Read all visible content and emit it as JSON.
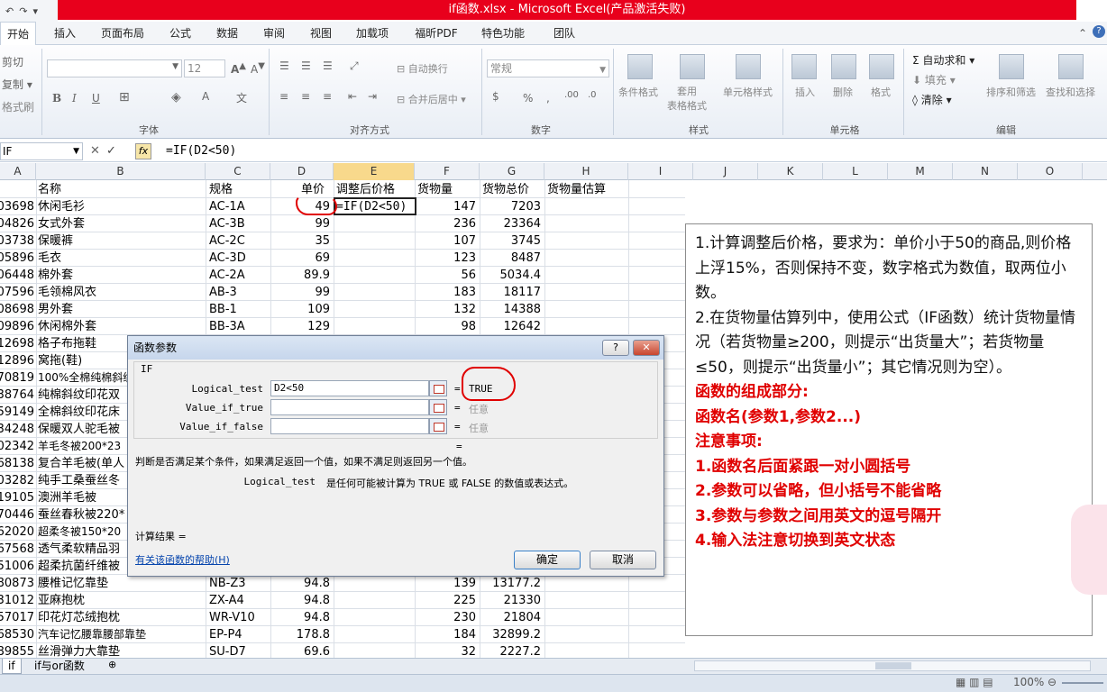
{
  "window": {
    "title": "if函数.xlsx - Microsoft Excel(产品激活失败)"
  },
  "tabs": [
    "开始",
    "插入",
    "页面布局",
    "公式",
    "数据",
    "审阅",
    "视图",
    "加载项",
    "福昕PDF",
    "特色功能",
    "团队"
  ],
  "ribbon": {
    "clipboard": {
      "cut": "剪切",
      "copy": "复制 ▾",
      "format_painter": "格式刷"
    },
    "font": {
      "size": "12",
      "group_label": "字体"
    },
    "alignment": {
      "wrap": "自动换行",
      "merge": "合并后居中 ▾",
      "group_label": "对齐方式"
    },
    "number": {
      "format": "常规",
      "group_label": "数字"
    },
    "styles": {
      "conditional": "条件格式",
      "table": "套用\n表格格式",
      "cell_styles": "单元格样式",
      "group_label": "样式"
    },
    "cells": {
      "insert": "插入",
      "delete": "删除",
      "format": "格式",
      "group_label": "单元格"
    },
    "editing": {
      "autosum": "自动求和 ▾",
      "fill": "填充 ▾",
      "clear": "清除 ▾",
      "sort_filter": "排序和筛选",
      "find_select": "查找和选择",
      "group_label": "编辑"
    }
  },
  "formula_bar": {
    "name_box": "IF",
    "formula": "=IF(D2<50)"
  },
  "columns": [
    "A",
    "B",
    "C",
    "D",
    "E",
    "F",
    "G",
    "H",
    "I",
    "J",
    "K",
    "L",
    "M",
    "N",
    "O"
  ],
  "header_row": {
    "b": "名称",
    "c": "规格",
    "d": "单价",
    "e": "调整后价格",
    "f": "货物量",
    "g": "货物总价",
    "h": "货物量估算"
  },
  "rows": [
    {
      "a": "03698",
      "b": "休闲毛衫",
      "c": "AC-1A",
      "d": "49",
      "e": "=IF(D2<50)",
      "f": "147",
      "g": "7203"
    },
    {
      "a": "04826",
      "b": "女式外套",
      "c": "AC-3B",
      "d": "99",
      "e": "",
      "f": "236",
      "g": "23364"
    },
    {
      "a": "03738",
      "b": "保暖裤",
      "c": "AC-2C",
      "d": "35",
      "e": "",
      "f": "107",
      "g": "3745"
    },
    {
      "a": "05896",
      "b": "毛衣",
      "c": "AC-3D",
      "d": "69",
      "e": "",
      "f": "123",
      "g": "8487"
    },
    {
      "a": "06448",
      "b": "棉外套",
      "c": "AC-2A",
      "d": "89.9",
      "e": "",
      "f": "56",
      "g": "5034.4"
    },
    {
      "a": "07596",
      "b": "毛领棉风衣",
      "c": "AB-3",
      "d": "99",
      "e": "",
      "f": "183",
      "g": "18117"
    },
    {
      "a": "08698",
      "b": "男外套",
      "c": "BB-1",
      "d": "109",
      "e": "",
      "f": "132",
      "g": "14388"
    },
    {
      "a": "09896",
      "b": "休闲棉外套",
      "c": "BB-3A",
      "d": "129",
      "e": "",
      "f": "98",
      "g": "12642"
    },
    {
      "a": "12698",
      "b": "格子布拖鞋",
      "c": "",
      "d": "",
      "e": "",
      "f": "",
      "g": ""
    },
    {
      "a": "12896",
      "b": "窝拖(鞋)",
      "c": "",
      "d": "",
      "e": "",
      "f": "",
      "g": ""
    },
    {
      "a": "70819",
      "b": "100%全棉纯棉斜纹",
      "c": "",
      "d": "",
      "e": "",
      "f": "",
      "g": ""
    },
    {
      "a": "38764",
      "b": "纯棉斜纹印花双",
      "c": "",
      "d": "",
      "e": "",
      "f": "",
      "g": ""
    },
    {
      "a": "59149",
      "b": "全棉斜纹印花床",
      "c": "",
      "d": "",
      "e": "",
      "f": "",
      "g": ""
    },
    {
      "a": "34248",
      "b": "保暖双人驼毛被",
      "c": "",
      "d": "",
      "e": "",
      "f": "",
      "g": ""
    },
    {
      "a": "02342",
      "b": "羊毛冬被200*23",
      "c": "",
      "d": "",
      "e": "",
      "f": "",
      "g": ""
    },
    {
      "a": "68138",
      "b": "复合羊毛被(单人",
      "c": "",
      "d": "",
      "e": "",
      "f": "",
      "g": ""
    },
    {
      "a": "03282",
      "b": "纯手工桑蚕丝冬",
      "c": "",
      "d": "",
      "e": "",
      "f": "",
      "g": ""
    },
    {
      "a": "19105",
      "b": "澳洲羊毛被",
      "c": "",
      "d": "",
      "e": "",
      "f": "",
      "g": ""
    },
    {
      "a": "70446",
      "b": "蚕丝春秋被220*",
      "c": "",
      "d": "",
      "e": "",
      "f": "",
      "g": ""
    },
    {
      "a": "62020",
      "b": "超柔冬被150*20",
      "c": "",
      "d": "",
      "e": "",
      "f": "",
      "g": ""
    },
    {
      "a": "67568",
      "b": "透气柔软精品羽",
      "c": "",
      "d": "",
      "e": "",
      "f": "",
      "g": ""
    },
    {
      "a": "51006",
      "b": "超柔抗菌纤维被",
      "c": "",
      "d": "",
      "e": "",
      "f": "",
      "g": ""
    },
    {
      "a": "80873",
      "b": "腰椎记忆靠垫",
      "c": "NB-Z3",
      "d": "94.8",
      "e": "",
      "f": "139",
      "g": "13177.2"
    },
    {
      "a": "31012",
      "b": "亚麻抱枕",
      "c": "ZX-A4",
      "d": "94.8",
      "e": "",
      "f": "225",
      "g": "21330"
    },
    {
      "a": "57017",
      "b": "印花灯芯绒抱枕",
      "c": "WR-V10",
      "d": "94.8",
      "e": "",
      "f": "230",
      "g": "21804"
    },
    {
      "a": "68530",
      "b": "汽车记忆腰靠腰部靠垫",
      "c": "EP-P4",
      "d": "178.8",
      "e": "",
      "f": "184",
      "g": "32899.2"
    },
    {
      "a": "89855",
      "b": "丝滑弹力大靠垫",
      "c": "SU-D7",
      "d": "69.6",
      "e": "",
      "f": "32",
      "g": "2227.2"
    }
  ],
  "dialog": {
    "title": "函数参数",
    "help_btn": "?",
    "close_btn": "✕",
    "function_name": "IF",
    "args": [
      {
        "label": "Logical_test",
        "value": "D2<50",
        "result": "TRUE"
      },
      {
        "label": "Value_if_true",
        "value": "",
        "result": "任意"
      },
      {
        "label": "Value_if_false",
        "value": "",
        "result": "任意"
      }
    ],
    "equals": "=",
    "description": "判断是否满足某个条件，如果满足返回一个值，如果不满足则返回另一个值。",
    "arg_label": "Logical_test",
    "arg_description": "是任何可能被计算为 TRUE 或 FALSE 的数值或表达式。",
    "calc_result": "计算结果 =",
    "help_link": "有关该函数的帮助(H)",
    "ok": "确定",
    "cancel": "取消"
  },
  "note": {
    "lines": [
      "1.计算调整后价格，要求为：单价小于50的商品,则价格上浮15%，否则保持不变，数字格式为数值，取两位小数。",
      "2.在货物量估算列中，使用公式（IF函数）统计货物量情况（若货物量≥200，则提示“出货量大”；若货物量≤50，则提示“出货量小”；其它情况则为空）。"
    ],
    "red_lines": [
      "函数的组成部分:",
      "函数名(参数1,参数2...)",
      "注意事项:",
      "1.函数名后面紧跟一对小圆括号",
      "2.参数可以省略，但小括号不能省略",
      "3.参数与参数之间用英文的逗号隔开",
      "4.输入法注意切换到英文状态"
    ]
  },
  "sheet_tabs": [
    "if",
    "if与or函数"
  ],
  "status": {
    "zoom": "100%"
  },
  "colors": {
    "title": "#e8001c",
    "annotation": "#e00000",
    "selected_col": "#f8d98c"
  }
}
